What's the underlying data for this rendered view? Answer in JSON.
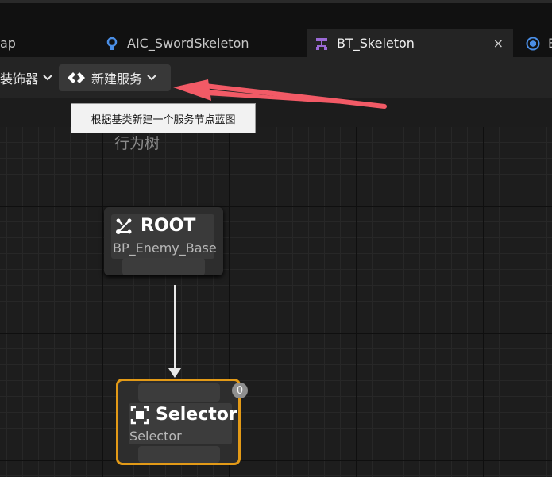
{
  "tabs": [
    {
      "label": "ap",
      "icon": "map-icon"
    },
    {
      "label": "AIC_SwordSkeleton",
      "icon": "ai-controller-icon"
    },
    {
      "label": "BT_Skeleton",
      "icon": "behavior-tree-icon",
      "active": true,
      "close": "×"
    },
    {
      "label": "B",
      "icon": "blueprint-icon"
    }
  ],
  "toolbar": {
    "decorator_label": "装饰器",
    "new_service_label": "新建服务"
  },
  "tooltip": "根据基类新建一个服务节点蓝图",
  "graph": {
    "title": "行为树",
    "root": {
      "title": "ROOT",
      "subtitle": "BP_Enemy_Base"
    },
    "selector": {
      "title": "Selector",
      "subtitle": "Selector",
      "badge": "0"
    }
  },
  "colors": {
    "accent_selected": "#e39a17",
    "annotation_arrow": "#f25a66",
    "tab_icon_purple": "#9b6ad6",
    "tab_icon_blue": "#4a8ee6"
  }
}
